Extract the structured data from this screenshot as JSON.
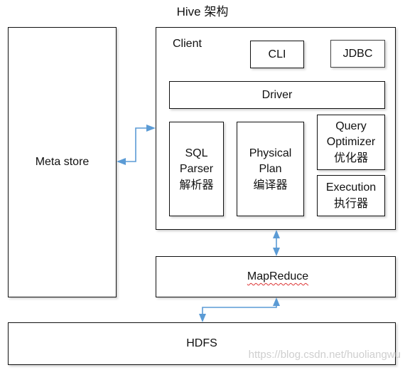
{
  "title": "Hive 架构",
  "metastore": {
    "label": "Meta store"
  },
  "client": {
    "label": "Client",
    "cli": "CLI",
    "jdbc": "JDBC",
    "driver": "Driver",
    "sql_parser": {
      "line1": "SQL",
      "line2": "Parser",
      "line3": "解析器"
    },
    "physical_plan": {
      "line1": "Physical",
      "line2": "Plan",
      "line3": "编译器"
    },
    "query_optimizer": {
      "line1": "Query",
      "line2": "Optimizer",
      "line3": "优化器"
    },
    "execution": {
      "line1": "Execution",
      "line2": "执行器"
    }
  },
  "mapreduce": {
    "label": "MapReduce"
  },
  "hdfs": {
    "label": "HDFS"
  },
  "watermark": "https://blog.csdn.net/huoliangwu",
  "colors": {
    "arrow": "#5b9bd5",
    "border": "#111111"
  }
}
